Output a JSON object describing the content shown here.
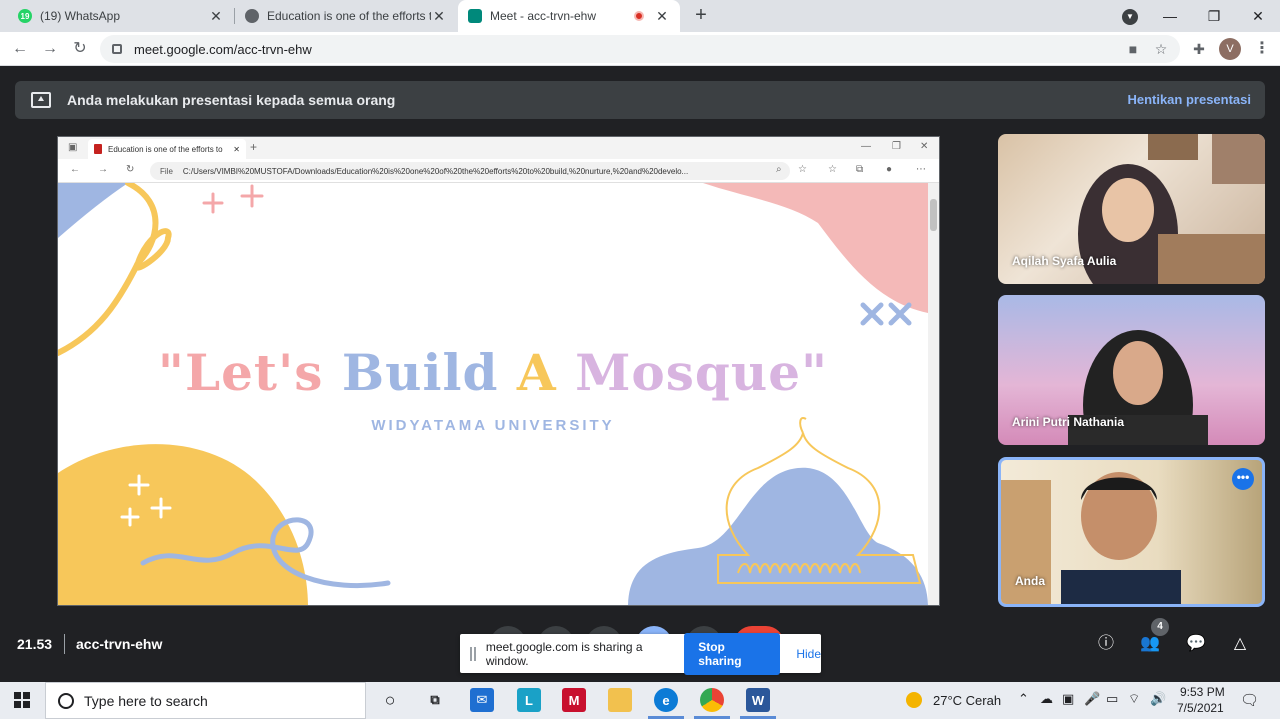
{
  "browser": {
    "tabs": [
      {
        "label": "(19) WhatsApp",
        "badge": "19"
      },
      {
        "label": "Education is one of the efforts to"
      },
      {
        "label": "Meet - acc-trvn-ehw"
      }
    ],
    "new_tab": "+",
    "url": "meet.google.com/acc-trvn-ehw",
    "profile_initial": "V"
  },
  "meet": {
    "banner_text": "Anda melakukan presentasi kepada semua orang",
    "banner_action": "Hentikan presentasi",
    "time": "21.53",
    "meeting_code": "acc-trvn-ehw",
    "participant_count": "4",
    "participants": [
      {
        "name": "Aqilah Syafa Aulia"
      },
      {
        "name": "Arini Putri Nathania"
      },
      {
        "name": "Anda"
      }
    ],
    "share_notice": {
      "text": "meet.google.com is sharing a window.",
      "stop_label": "Stop sharing",
      "hide_label": "Hide"
    }
  },
  "shared_window": {
    "tab_title": "Education is one of the efforts to",
    "file_label": "File",
    "address": "C:/Users/VIMBI%20MUSTOFA/Downloads/Education%20is%20one%20of%20the%20efforts%20to%20build,%20nurture,%20and%20develo...",
    "slide_title": "\"Let's Build A Mosque\"",
    "slide_subtitle": "WIDYATAMA UNIVERSITY"
  },
  "taskbar": {
    "search_placeholder": "Type here to search",
    "weather": "27°C  Cerah",
    "clock_time": "9:53 PM",
    "clock_date": "7/5/2021"
  },
  "colors": {
    "meet_bg": "#202124",
    "accent_blue": "#8ab4f8",
    "stop_button": "#1a73e8",
    "slide_pink": "#f4a7a9",
    "slide_blue": "#9fb6e2",
    "slide_yellow": "#f7c75a"
  }
}
